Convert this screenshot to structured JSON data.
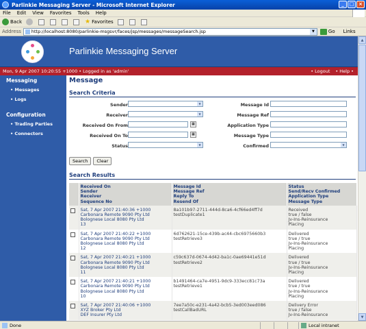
{
  "window": {
    "title": "Parlinkie Messaging Server - Microsoft Internet Explorer"
  },
  "menu": [
    "File",
    "Edit",
    "View",
    "Favorites",
    "Tools",
    "Help"
  ],
  "toolbar": {
    "back": "Back",
    "favorites": "Favorites"
  },
  "address": {
    "label": "Address",
    "url": "http://localhost:8080/parlinkie-msgsvr/faces/jsp/messages/messageSearch.jsp",
    "go": "Go",
    "links": "Links"
  },
  "header": {
    "title": "Parlinkie Messaging Server"
  },
  "statusline": {
    "text": "Mon, 9 Apr 2007 10:20:55 +1000 • Logged in as 'admin'",
    "logout": "• Logout",
    "help": "• Help •"
  },
  "sidebar": {
    "sections": [
      {
        "title": "Messaging",
        "items": [
          "• Messages",
          "• Logs"
        ]
      },
      {
        "title": "Configuration",
        "items": [
          "• Trading Parties",
          "• Connectors"
        ]
      }
    ]
  },
  "page": {
    "title": "Message"
  },
  "criteria": {
    "title": "Search Criteria",
    "sender": "Sender",
    "receiver": "Receiver",
    "received_from": "Received On From",
    "received_to": "Received On To",
    "status": "Status",
    "message_id": "Message Id",
    "message_ref": "Message Ref",
    "application_type": "Application Type",
    "message_type": "Message Type",
    "confirmed": "Confirmed",
    "search_button": "Search",
    "clear_button": "Clear"
  },
  "results": {
    "title": "Search Results",
    "headers": [
      [
        "Received On",
        "Sender",
        "Receiver",
        "Sequence No"
      ],
      [
        "Message Id",
        "Message Ref",
        "Reply To",
        "Resend Of"
      ],
      [
        "Status",
        "Send/Recv Confirmed",
        "Application Type",
        "Message Type"
      ]
    ],
    "rows": [
      {
        "received": "Sat, 7 Apr 2007 21:40:36 +1000",
        "sender": "Carbonara Remote 9090 Pty Ltd",
        "receiver": "Bolognese Local 8080 Pty Ltd",
        "seq": "13",
        "message_id": "8a101b97-2711-444d-8ca6-4cf66ed4ff7d",
        "message_ref": "testDuplicate1",
        "status": "Received",
        "confirmed": "true / false",
        "app_type": "Jv-Ins-Reinsurance",
        "msg_type": "Placing"
      },
      {
        "received": "Sat, 7 Apr 2007 21:40:22 +1000",
        "sender": "Carbonara Remote 9090 Pty Ltd",
        "receiver": "Bolognese Local 8080 Pty Ltd",
        "seq": "12",
        "message_id": "6d762621-15ce-439b-ac44-cbc6975660b3",
        "message_ref": "testRetrieve3",
        "status": "Delivered",
        "confirmed": "true / true",
        "app_type": "Jv-Ins-Reinsurance",
        "msg_type": "Placing"
      },
      {
        "received": "Sat, 7 Apr 2007 21:40:21 +1000",
        "sender": "Carbonara Remote 9090 Pty Ltd",
        "receiver": "Bolognese Local 8080 Pty Ltd",
        "seq": "11",
        "message_id": "c59c637d-0674-4d42-ba1c-0ae69441e51d",
        "message_ref": "testRetrieve2",
        "status": "Delivered",
        "confirmed": "true / true",
        "app_type": "Jv-Ins-Reinsurance",
        "msg_type": "Placing"
      },
      {
        "received": "Sat, 7 Apr 2007 21:40:21 +1000",
        "sender": "Carbonara Remote 9090 Pty Ltd",
        "receiver": "Bolognese Local 8080 Pty Ltd",
        "seq": "10",
        "message_id": "b1491464-ca7e-4951-9dc9-333ecc81c73a",
        "message_ref": "testRetrieve1",
        "status": "Delivered",
        "confirmed": "true / true",
        "app_type": "Jv-Ins-Reinsurance",
        "msg_type": "Placing"
      },
      {
        "received": "Sat, 7 Apr 2007 21:40:06 +1000",
        "sender": "XYZ Broker Pty Ltd",
        "receiver": "DEF Insurer Pty Ltd",
        "seq": "",
        "message_id": "7ee7a50c-e231-4a42-bcb5-3ed003eed086",
        "message_ref": "testCallBadURL",
        "status": "Delivery Error",
        "confirmed": "true / false",
        "app_type": "Jv-Ins-Reinsurance",
        "msg_type": ""
      }
    ]
  },
  "statusbar": {
    "left": "Done",
    "zone": "Local intranet"
  },
  "colors": {
    "brand_blue": "#2f5ca8",
    "status_red": "#b3212b",
    "heading": "#1f3e7c"
  }
}
